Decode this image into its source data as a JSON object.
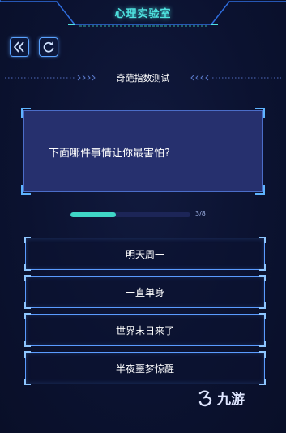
{
  "header": {
    "title": "心理实验室"
  },
  "toolbar": {
    "back_icon": "double-chevron-left-icon",
    "refresh_icon": "refresh-icon"
  },
  "section": {
    "title": "奇葩指数测试"
  },
  "question": {
    "text": "下面哪件事情让你最害怕?"
  },
  "progress": {
    "current": 3,
    "total": 8,
    "label": "3/8"
  },
  "options": [
    {
      "label": "明天周一"
    },
    {
      "label": "一直单身"
    },
    {
      "label": "世界末日来了"
    },
    {
      "label": "半夜噩梦惊醒"
    }
  ],
  "watermark": {
    "logo_icon": "9game-logo-icon",
    "text": "九游"
  },
  "colors": {
    "background": "#0c1330",
    "accent": "#4fe3e0",
    "card": "#26306e",
    "border": "#5a9bff",
    "progress": "#3fd6c6"
  }
}
